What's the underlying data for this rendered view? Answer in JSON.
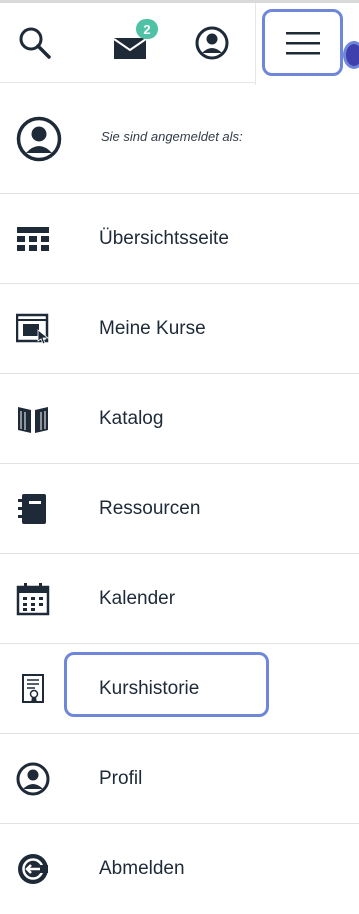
{
  "topbar": {
    "search": {
      "icon": "search-icon"
    },
    "messages": {
      "icon": "envelope-icon",
      "badge_count": "2"
    },
    "profile": {
      "icon": "user-circle-icon"
    },
    "menu": {
      "icon": "hamburger-menu-icon"
    }
  },
  "account": {
    "icon": "user-circle-icon",
    "logged_in_label": "Sie sind angemeldet als:"
  },
  "nav": {
    "items": [
      {
        "label": "Übersichtsseite",
        "icon": "dashboard-grid-icon"
      },
      {
        "label": "Meine Kurse",
        "icon": "course-screen-icon"
      },
      {
        "label": "Katalog",
        "icon": "open-book-icon"
      },
      {
        "label": "Ressourcen",
        "icon": "notebook-icon"
      },
      {
        "label": "Kalender",
        "icon": "calendar-icon"
      },
      {
        "label": "Kurshistorie",
        "icon": "certificate-icon"
      },
      {
        "label": "Profil",
        "icon": "user-circle-icon"
      },
      {
        "label": "Abmelden",
        "icon": "logout-icon"
      }
    ]
  },
  "colors": {
    "text": "#1e2a38",
    "focus_ring": "#6f87d8",
    "badge": "#4fc2a5",
    "divider": "#e2e2e2"
  }
}
